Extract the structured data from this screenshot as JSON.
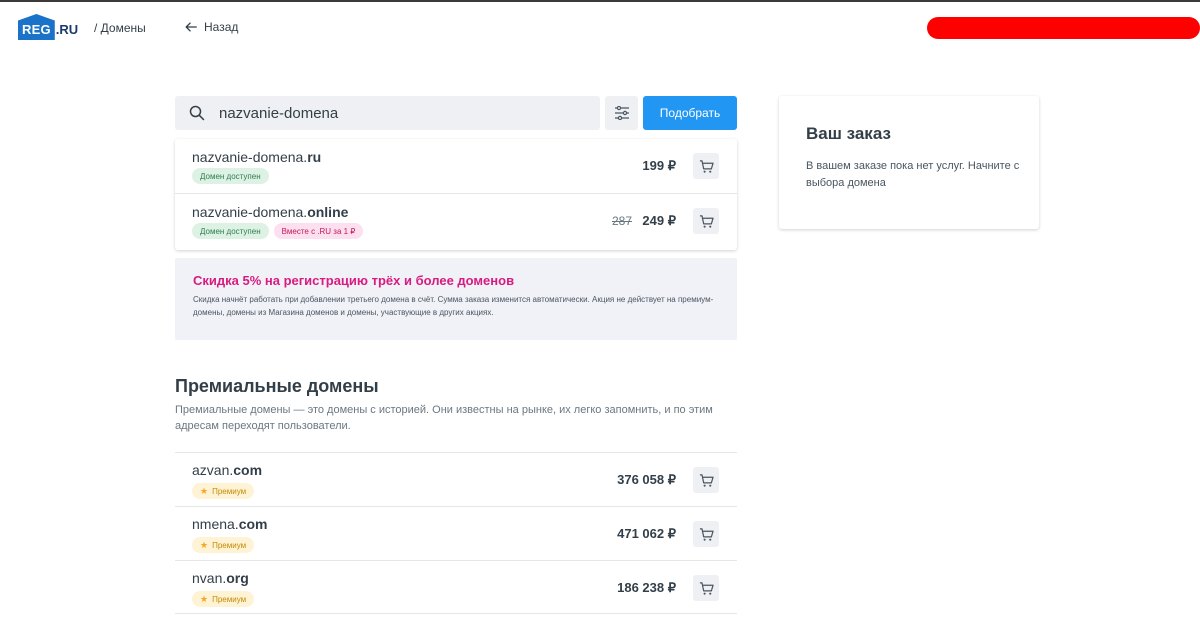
{
  "header": {
    "logo_text": "REG",
    "logo_suffix": ".RU",
    "breadcrumb": "/ Домены",
    "back_label": "Назад"
  },
  "search": {
    "value": "nazvanie-domena",
    "submit_label": "Подобрать"
  },
  "results": [
    {
      "name": "nazvanie-domena.",
      "tld": "ru",
      "badges": [
        "Домен доступен"
      ],
      "price": "199 ₽"
    },
    {
      "name": "nazvanie-domena.",
      "tld": "online",
      "badges": [
        "Домен доступен",
        "Вместе с .RU за 1 ₽"
      ],
      "old_price": "287",
      "price": "249 ₽"
    }
  ],
  "promo": {
    "title": "Скидка 5% на регистрацию трёх и более доменов",
    "text": "Скидка начнёт работать при добавлении третьего домена в счёт. Сумма заказа изменится автоматически. Акция не действует на премиум-домены, домены из Магазина доменов и домены, участвующие в других акциях."
  },
  "premium": {
    "title": "Премиальные домены",
    "description": "Премиальные домены — это домены с историей. Они известны на рынке, их легко запомнить, и по этим адресам переходят пользователи.",
    "items": [
      {
        "name": "azvan.",
        "tld": "com",
        "badge": "Премиум",
        "price": "376 058 ₽"
      },
      {
        "name": "nmena.",
        "tld": "com",
        "badge": "Премиум",
        "price": "471 062 ₽"
      },
      {
        "name": "nvan.",
        "tld": "org",
        "badge": "Премиум",
        "price": "186 238 ₽"
      }
    ]
  },
  "order": {
    "title": "Ваш заказ",
    "text": "В вашем заказе пока нет услуг. Начните с выбора домена"
  },
  "colors": {
    "accent": "#2196f3",
    "promo_title": "#d81b80",
    "available_badge": "#ddf2e4",
    "premium_badge": "#fff3d6",
    "redaction": "#ff0000"
  },
  "icons": {
    "search": "search-icon",
    "filter": "filter-icon",
    "cart": "cart-icon",
    "back": "arrow-left-icon",
    "star": "star-icon"
  }
}
